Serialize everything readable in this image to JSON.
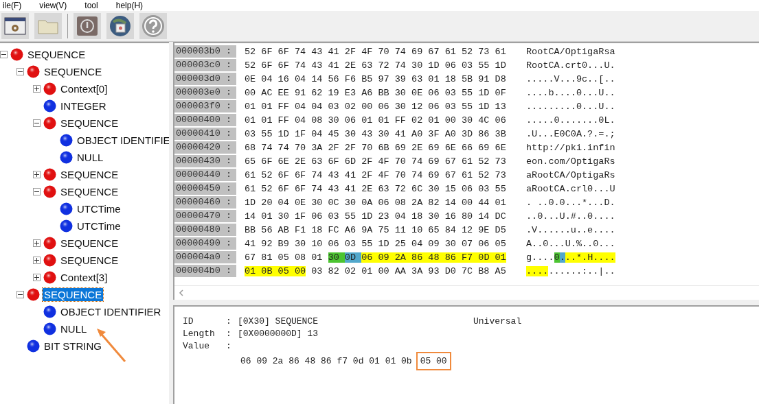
{
  "menu": [
    "ile(F)",
    "view(V)",
    "tool",
    "help(H)"
  ],
  "toolbar": [
    {
      "kind": "window"
    },
    {
      "kind": "folder"
    },
    {
      "kind": "separator"
    },
    {
      "kind": "power"
    },
    {
      "kind": "globe"
    },
    {
      "kind": "help"
    }
  ],
  "tree": [
    {
      "label": "SEQUENCE",
      "color": "#e01010",
      "expanded": true,
      "selected": false,
      "children": [
        {
          "label": "SEQUENCE",
          "color": "#e01010",
          "expanded": true,
          "selected": false,
          "children": [
            {
              "label": "Context[0]",
              "color": "#e01010",
              "expanded": false,
              "selected": false
            },
            {
              "label": "INTEGER",
              "color": "#1030e0",
              "selected": false
            },
            {
              "label": "SEQUENCE",
              "color": "#e01010",
              "expanded": true,
              "selected": false,
              "children": [
                {
                  "label": "OBJECT IDENTIFIE",
                  "color": "#1030e0",
                  "selected": false
                },
                {
                  "label": "NULL",
                  "color": "#1030e0",
                  "selected": false
                }
              ]
            },
            {
              "label": "SEQUENCE",
              "color": "#e01010",
              "expanded": false,
              "selected": false
            },
            {
              "label": "SEQUENCE",
              "color": "#e01010",
              "expanded": true,
              "selected": false,
              "children": [
                {
                  "label": "UTCTime",
                  "color": "#1030e0",
                  "selected": false
                },
                {
                  "label": "UTCTime",
                  "color": "#1030e0",
                  "selected": false
                }
              ]
            },
            {
              "label": "SEQUENCE",
              "color": "#e01010",
              "expanded": false,
              "selected": false
            },
            {
              "label": "SEQUENCE",
              "color": "#e01010",
              "expanded": false,
              "selected": false
            },
            {
              "label": "Context[3]",
              "color": "#e01010",
              "expanded": false,
              "selected": false
            }
          ]
        },
        {
          "label": "SEQUENCE",
          "color": "#e01010",
          "expanded": true,
          "selected": true,
          "children": [
            {
              "label": "OBJECT IDENTIFIER",
              "color": "#1030e0",
              "selected": false
            },
            {
              "label": "NULL",
              "color": "#1030e0",
              "selected": false
            }
          ]
        },
        {
          "label": "BIT STRING",
          "color": "#1030e0",
          "selected": false
        }
      ]
    }
  ],
  "hex_rows": [
    {
      "offset": "000003b0 :",
      "hex": [
        {
          "text": "52 6F 6F 74 43 41 2F 4F 70 74 69 67 61 52 73 61"
        }
      ],
      "ascii": [
        {
          "text": "RootCA/OptigaRsa"
        }
      ]
    },
    {
      "offset": "000003c0 :",
      "hex": [
        {
          "text": "52 6F 6F 74 43 41 2E 63 72 74 30 1D 06 03 55 1D"
        }
      ],
      "ascii": [
        {
          "text": "RootCA.crt0...U."
        }
      ]
    },
    {
      "offset": "000003d0 :",
      "hex": [
        {
          "text": "0E 04 16 04 14 56 F6 B5 97 39 63 01 18 5B 91 D8"
        }
      ],
      "ascii": [
        {
          "text": ".....V...9c..[.."
        }
      ]
    },
    {
      "offset": "000003e0 :",
      "hex": [
        {
          "text": "00 AC EE 91 62 19 E3 A6 BB 30 0E 06 03 55 1D 0F"
        }
      ],
      "ascii": [
        {
          "text": "....b....0...U.."
        }
      ]
    },
    {
      "offset": "000003f0 :",
      "hex": [
        {
          "text": "01 01 FF 04 04 03 02 00 06 30 12 06 03 55 1D 13"
        }
      ],
      "ascii": [
        {
          "text": ".........0...U.."
        }
      ]
    },
    {
      "offset": "00000400 :",
      "hex": [
        {
          "text": "01 01 FF 04 08 30 06 01 01 FF 02 01 00 30 4C 06"
        }
      ],
      "ascii": [
        {
          "text": ".....0.......0L."
        }
      ]
    },
    {
      "offset": "00000410 :",
      "hex": [
        {
          "text": "03 55 1D 1F 04 45 30 43 30 41 A0 3F A0 3D 86 3B"
        }
      ],
      "ascii": [
        {
          "text": ".U...E0C0A.?.=.;"
        }
      ]
    },
    {
      "offset": "00000420 :",
      "hex": [
        {
          "text": "68 74 74 70 3A 2F 2F 70 6B 69 2E 69 6E 66 69 6E"
        }
      ],
      "ascii": [
        {
          "text": "http://pki.infin"
        }
      ]
    },
    {
      "offset": "00000430 :",
      "hex": [
        {
          "text": "65 6F 6E 2E 63 6F 6D 2F 4F 70 74 69 67 61 52 73"
        }
      ],
      "ascii": [
        {
          "text": "eon.com/OptigaRs"
        }
      ]
    },
    {
      "offset": "00000440 :",
      "hex": [
        {
          "text": "61 52 6F 6F 74 43 41 2F 4F 70 74 69 67 61 52 73"
        }
      ],
      "ascii": [
        {
          "text": "aRootCA/OptigaRs"
        }
      ]
    },
    {
      "offset": "00000450 :",
      "hex": [
        {
          "text": "61 52 6F 6F 74 43 41 2E 63 72 6C 30 15 06 03 55"
        }
      ],
      "ascii": [
        {
          "text": "aRootCA.crl0...U"
        }
      ]
    },
    {
      "offset": "00000460 :",
      "hex": [
        {
          "text": "1D 20 04 0E 30 0C 30 0A 06 08 2A 82 14 00 44 01"
        }
      ],
      "ascii": [
        {
          "text": ". ..0.0...*...D."
        }
      ]
    },
    {
      "offset": "00000470 :",
      "hex": [
        {
          "text": "14 01 30 1F 06 03 55 1D 23 04 18 30 16 80 14 DC"
        }
      ],
      "ascii": [
        {
          "text": "..0...U.#..0...."
        }
      ]
    },
    {
      "offset": "00000480 :",
      "hex": [
        {
          "text": "BB 56 AB F1 18 FC A6 9A 75 11 10 65 84 12 9E D5"
        }
      ],
      "ascii": [
        {
          "text": ".V......u..e...."
        }
      ]
    },
    {
      "offset": "00000490 :",
      "hex": [
        {
          "text": "41 92 B9 30 10 06 03 55 1D 25 04 09 30 07 06 05"
        }
      ],
      "ascii": [
        {
          "text": "A..0...U.%..0..."
        }
      ]
    },
    {
      "offset": "000004a0 :",
      "hex": [
        {
          "text": "67 81 05 08 01 "
        },
        {
          "text": "30 ",
          "color": "#4cc431"
        },
        {
          "text": "0D ",
          "color": "#52a8cc"
        },
        {
          "text": "06 09 2A 86 48 86 F7 0D 01",
          "color": "#ffff00"
        }
      ],
      "ascii": [
        {
          "text": "g...."
        },
        {
          "text": "0",
          "color": "#4cc431"
        },
        {
          "text": ".",
          "color": "#52a8cc"
        },
        {
          "text": "..*.H....",
          "color": "#ffff00"
        }
      ]
    },
    {
      "offset": "000004b0 :",
      "hex": [
        {
          "text": "01 0B 05 00",
          "color": "#ffff00"
        },
        {
          "text": " 03 82 02 01 00 AA 3A 93 D0 7C B8 A5"
        }
      ],
      "ascii": [
        {
          "text": "....",
          "color": "#ffff00"
        },
        {
          "text": "......:..|.."
        }
      ]
    }
  ],
  "info": {
    "id_label": "ID",
    "id_colon": ":",
    "length_colon": ":",
    "value_colon": ":",
    "id_value": "[0X30] SEQUENCE",
    "class": "Universal",
    "length_label": "Length",
    "length_value": "[0X0000000D] 13",
    "value_label": "Value",
    "value_bytes": [
      {
        "text": "06 09 2a 86 48 86 f7 0d 01 01 0b",
        "boxed": false
      },
      {
        "text": "05 00",
        "boxed": true
      }
    ]
  },
  "annotation": {
    "kind": "arrow"
  }
}
